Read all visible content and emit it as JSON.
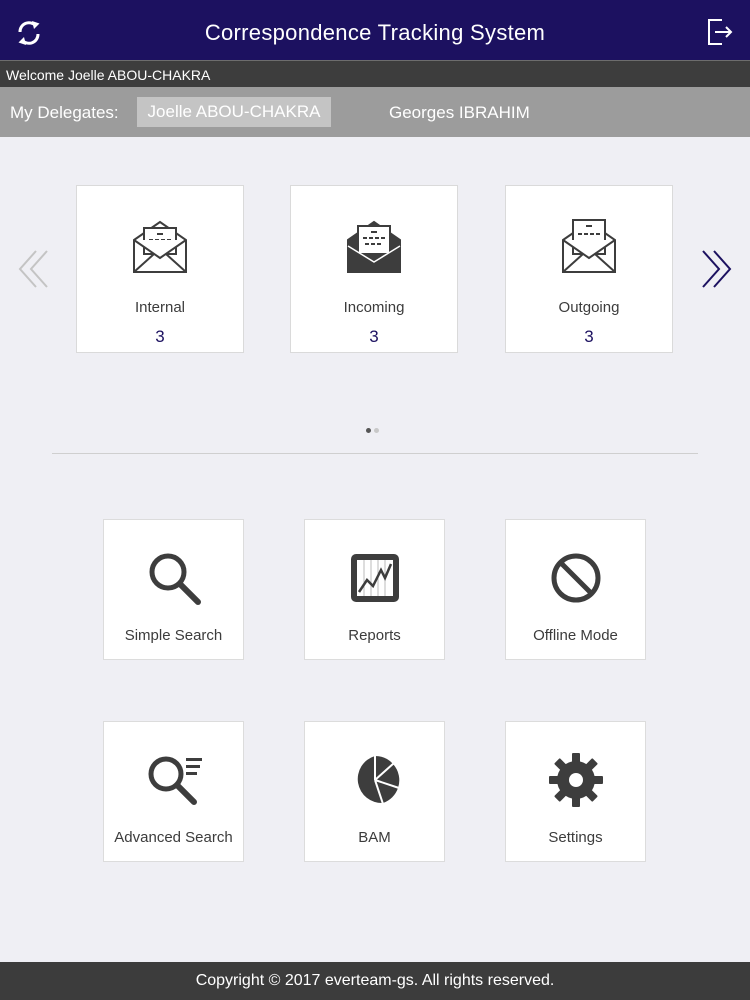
{
  "header": {
    "title": "Correspondence Tracking System",
    "refresh_icon": "refresh-icon",
    "logout_icon": "logout-icon"
  },
  "welcome": {
    "text": "Welcome Joelle ABOU-CHAKRA"
  },
  "delegates": {
    "label": "My Delegates:",
    "items": [
      {
        "name": "Joelle ABOU-CHAKRA",
        "selected": true
      },
      {
        "name": "Georges IBRAHIM",
        "selected": false
      }
    ]
  },
  "carousel": {
    "cards": [
      {
        "label": "Internal",
        "count": "3",
        "icon": "envelope-open-icon"
      },
      {
        "label": "Incoming",
        "count": "3",
        "icon": "envelope-incoming-icon"
      },
      {
        "label": "Outgoing",
        "count": "3",
        "icon": "envelope-outgoing-icon"
      }
    ],
    "page_count": 2,
    "active_page": 1,
    "colors": {
      "accent": "#1c1160",
      "arrow_disabled": "#c4c4c4"
    }
  },
  "tiles": [
    {
      "label": "Simple Search",
      "icon": "search-icon"
    },
    {
      "label": "Reports",
      "icon": "reports-icon"
    },
    {
      "label": "Offline Mode",
      "icon": "offline-icon"
    },
    {
      "label": "Advanced Search",
      "icon": "advanced-search-icon"
    },
    {
      "label": "BAM",
      "icon": "pie-chart-icon"
    },
    {
      "label": "Settings",
      "icon": "gear-icon"
    }
  ],
  "footer": {
    "text": "Copyright © 2017 everteam-gs. All rights reserved."
  }
}
